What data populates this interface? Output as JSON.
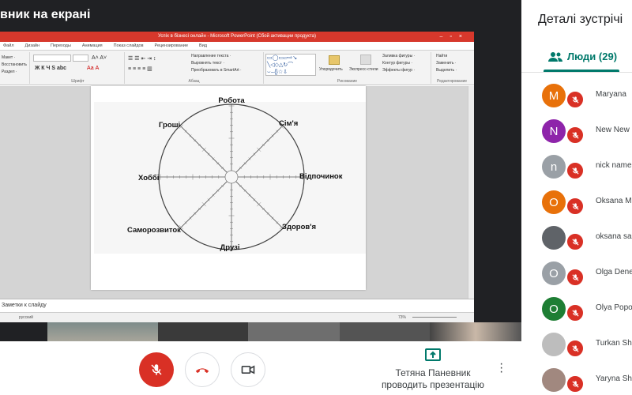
{
  "meeting": {
    "title_fragment": "вник на екрані"
  },
  "ppt": {
    "window_title": "Успіх в бізнесі онлайн - Microsoft PowerPoint (Сбой активации продукта)",
    "tabs": [
      "Файл",
      "Дизайн",
      "Переходы",
      "Анимация",
      "Показ слайдов",
      "Рецензирование",
      "Вид"
    ],
    "groups": {
      "font": "Шрифт",
      "paragraph": "Абзац",
      "drawing": "Рисование",
      "editing": "Редактирование"
    },
    "ribbon": {
      "macet": "Макет ·",
      "restore": "Восстановить",
      "section": "Раздел ·",
      "text_direction": "Направление текста ·",
      "align_text": "Выровнять текст ·",
      "smartart": "Преобразовать в SmartArt ·",
      "arrange": "Упорядочить",
      "quick_styles": "Экспресс-стили",
      "fill": "Заливка фигуры ·",
      "outline": "Контур фигуры ·",
      "effects": "Эффекты фигур ·",
      "find": "Найти",
      "replace": "Заменить ·",
      "select": "Выделить ·"
    },
    "notes": "Заметки к слайду",
    "status": {
      "lang": "русский",
      "zoom": "73%"
    }
  },
  "slide": {
    "labels": {
      "top": "Робота",
      "top_right": "Сім'я",
      "right": "Відпочинок",
      "bottom_right": "Здоров'я",
      "bottom": "Друзі",
      "bottom_left": "Саморозвиток",
      "left": "Хоббі",
      "top_left": "Гроші"
    }
  },
  "presenter": {
    "name": "Тетяна Паневник",
    "status": "проводить презентацію"
  },
  "panel": {
    "title": "Деталі зустрічі",
    "people_tab": "Люди (29)",
    "participants": [
      {
        "initial": "M",
        "name": "Maryana",
        "color": "#e8710a"
      },
      {
        "initial": "N",
        "name": "New New",
        "color": "#8e24aa"
      },
      {
        "initial": "n",
        "name": "nick name",
        "color": "#9aa0a6"
      },
      {
        "initial": "O",
        "name": "Oksana M",
        "color": "#e8710a"
      },
      {
        "initial": "",
        "name": "oksana sa",
        "color": "#5f6368"
      },
      {
        "initial": "O",
        "name": "Olga Dene",
        "color": "#9aa0a6"
      },
      {
        "initial": "O",
        "name": "Olya Popo",
        "color": "#1e7e34"
      },
      {
        "initial": "",
        "name": "Turkan Sh",
        "color": "#bdbdbd"
      },
      {
        "initial": "",
        "name": "Yaryna Sh",
        "color": "#a1887f"
      }
    ]
  },
  "colors": {
    "accent": "#00796b",
    "end_call": "#d93025",
    "ppt_title": "#d7382c"
  }
}
